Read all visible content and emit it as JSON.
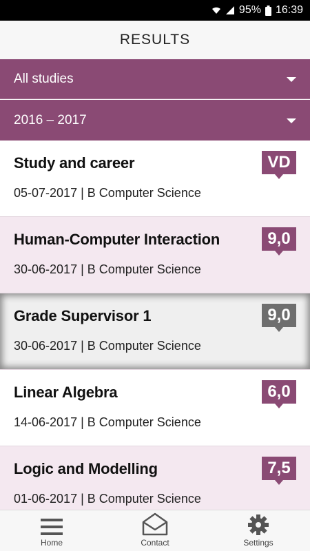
{
  "status_bar": {
    "battery": "95%",
    "time": "16:39"
  },
  "header": {
    "title": "RESULTS"
  },
  "filters": {
    "study": "All studies",
    "year": "2016 – 2017"
  },
  "results": [
    {
      "course": "Study and career",
      "date": "05-07-2017",
      "program": "B Computer Science",
      "grade": "VD"
    },
    {
      "course": "Human-Computer Interaction",
      "date": "30-06-2017",
      "program": "B Computer Science",
      "grade": "9,0"
    },
    {
      "course": "Grade Supervisor 1",
      "date": "30-06-2017",
      "program": "B Computer Science",
      "grade": "9,0"
    },
    {
      "course": "Linear Algebra",
      "date": "14-06-2017",
      "program": "B Computer Science",
      "grade": "6,0"
    },
    {
      "course": "Logic and Modelling",
      "date": "01-06-2017",
      "program": "B Computer Science",
      "grade": "7,5"
    }
  ],
  "nav": {
    "home": "Home",
    "contact": "Contact",
    "settings": "Settings"
  },
  "colors": {
    "accent": "#8a4a74",
    "grade_selected": "#6e6e6e",
    "row_alt": "#f4e8f0"
  }
}
